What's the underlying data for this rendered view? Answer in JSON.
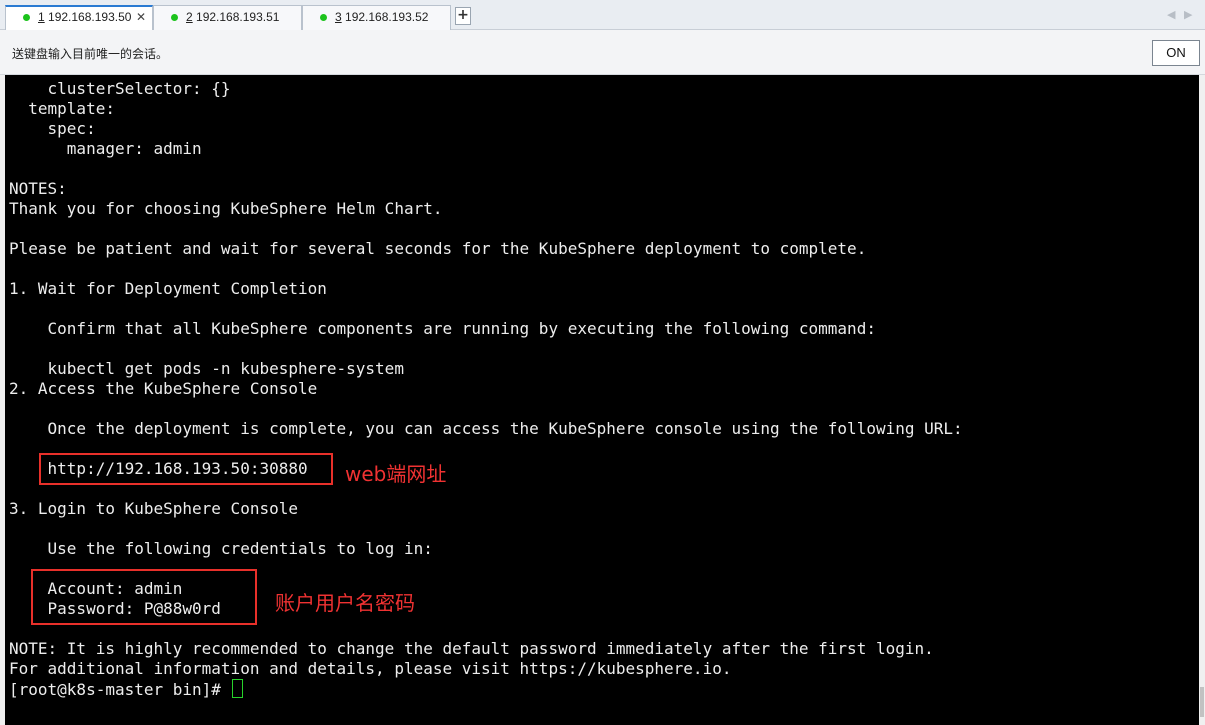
{
  "tabs": [
    {
      "num": "1",
      "host": " 192.168.193.50",
      "active": true
    },
    {
      "num": "2",
      "host": " 192.168.193.51",
      "active": false
    },
    {
      "num": "3",
      "host": " 192.168.193.52",
      "active": false
    }
  ],
  "tab_close": "✕",
  "new_tab": "+",
  "nav_left": "◀",
  "nav_right": "▶",
  "infobar": {
    "text": "送键盘输入目前唯一的会话。",
    "toggle_label": "ON"
  },
  "terminal": {
    "lines": [
      "    clusterSelector: {}",
      "  template:",
      "    spec:",
      "      manager: admin",
      "",
      "NOTES:",
      "Thank you for choosing KubeSphere Helm Chart.",
      "",
      "Please be patient and wait for several seconds for the KubeSphere deployment to complete.",
      "",
      "1. Wait for Deployment Completion",
      "",
      "    Confirm that all KubeSphere components are running by executing the following command:",
      "",
      "    kubectl get pods -n kubesphere-system",
      "2. Access the KubeSphere Console",
      "",
      "    Once the deployment is complete, you can access the KubeSphere console using the following URL:",
      "",
      "    http://192.168.193.50:30880",
      "",
      "3. Login to KubeSphere Console",
      "",
      "    Use the following credentials to log in:",
      "",
      "    Account: admin",
      "    Password: P@88w0rd",
      "",
      "NOTE: It is highly recommended to change the default password immediately after the first login.",
      "For additional information and details, please visit https://kubesphere.io.",
      "[root@k8s-master bin]# "
    ]
  },
  "annotations": {
    "url_note": "web端网址",
    "credentials_note": "账户用户名密码"
  },
  "colors": {
    "terminal_bg": "#000000",
    "terminal_fg": "#ededed",
    "annotation_red": "#e8302a",
    "cursor_green": "#28d32b",
    "active_tab_accent": "#2a7ad2"
  }
}
